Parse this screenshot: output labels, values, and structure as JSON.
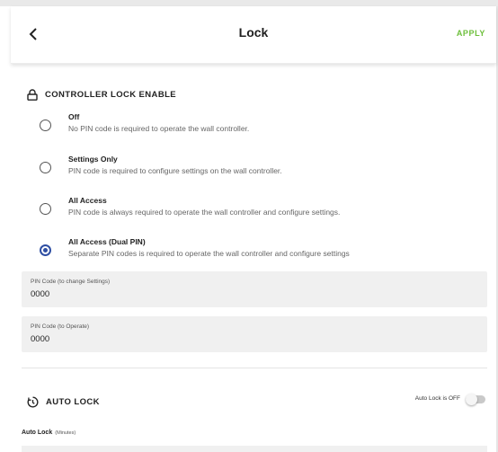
{
  "header": {
    "title": "Lock",
    "apply_label": "APPLY"
  },
  "controller_lock": {
    "title": "CONTROLLER LOCK ENABLE",
    "options": [
      {
        "title": "Off",
        "description": "No PIN code is required to operate the wall controller.",
        "selected": false
      },
      {
        "title": "Settings Only",
        "description": "PIN code is required to configure settings on the wall controller.",
        "selected": false
      },
      {
        "title": "All Access",
        "description": "PIN code is always required to operate the wall controller and configure settings.",
        "selected": false
      },
      {
        "title": "All Access (Dual PIN)",
        "description": "Separate PIN codes is required to operate the wall controller and configure settings",
        "selected": true
      }
    ]
  },
  "pin_settings": {
    "label": "PIN Code (to change Settings)",
    "value": "0000"
  },
  "pin_operate": {
    "label": "PIN Code (to Operate)",
    "value": "0000"
  },
  "auto_lock": {
    "title": "AUTO LOCK",
    "toggle_label": "Auto Lock is OFF",
    "toggle_on": false,
    "field_label": "Auto Lock",
    "field_unit": "(Minutes)"
  },
  "colors": {
    "accent_green": "#6dbf3b",
    "radio_selected": "#2f4fa3",
    "field_bg": "#f0f0f0"
  },
  "icons": {
    "back": "chevron-left-icon",
    "lock": "lock-icon",
    "auto_lock": "timer-icon"
  }
}
